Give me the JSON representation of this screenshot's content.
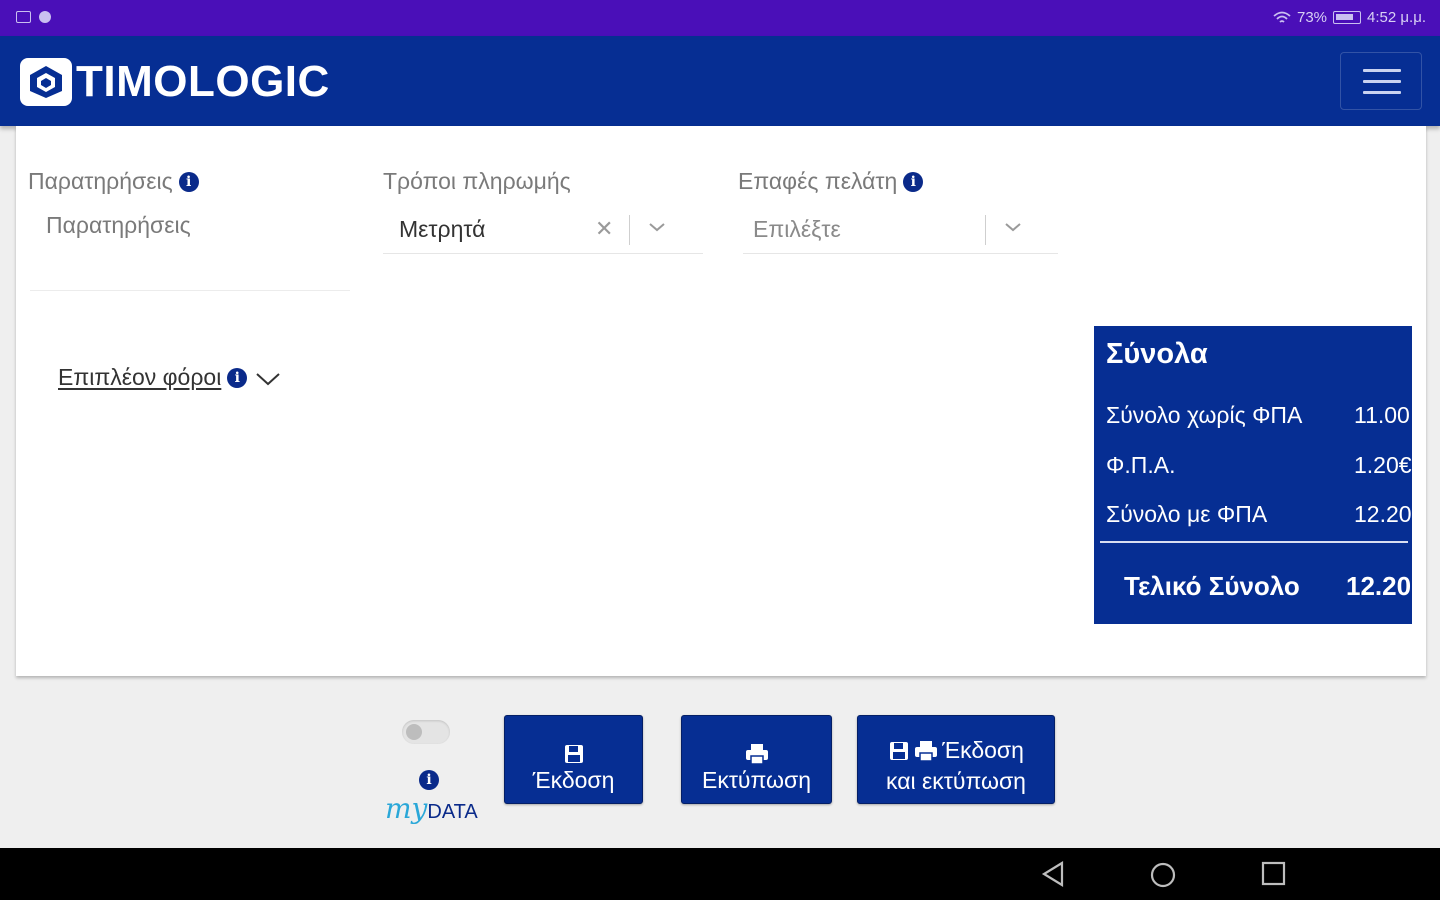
{
  "statusbar": {
    "battery": "73%",
    "time": "4:52 μ.μ."
  },
  "app": {
    "title": "TIMOLOGIC"
  },
  "form": {
    "notes_label": "Παρατηρήσεις",
    "notes_placeholder": "Παρατηρήσεις",
    "payment_label": "Τρόποι πληρωμής",
    "payment_value": "Μετρητά",
    "contacts_label": "Επαφές πελάτη",
    "contacts_placeholder": "Επιλέξτε",
    "extra_taxes": "Επιπλέον φόροι"
  },
  "totals": {
    "title": "Σύνολα",
    "rows": [
      {
        "label": "Σύνολο χωρίς ΦΠΑ",
        "value": "11.00"
      },
      {
        "label": "Φ.Π.Α.",
        "value": "1.20€"
      },
      {
        "label": "Σύνολο με ΦΠΑ",
        "value": "12.20"
      }
    ],
    "final_label": "Τελικό Σύνολο",
    "final_value": "12.20"
  },
  "mydata": {
    "my": "my",
    "data": "DATA"
  },
  "actions": {
    "issue": "Έκδοση",
    "print": "Εκτύπωση",
    "issue_print_line1": "Έκδοση",
    "issue_print_line2": "και εκτύπωση"
  },
  "icons": [
    "wifi-icon",
    "battery-icon",
    "menu-icon",
    "info-icon",
    "chevron-down-icon",
    "close-icon",
    "save-icon",
    "printer-icon",
    "back-icon",
    "home-icon",
    "recents-icon"
  ],
  "colors": {
    "primary": "#062e93",
    "statusbar": "#4a0fb8",
    "mydata_accent": "#2aa7d8"
  }
}
